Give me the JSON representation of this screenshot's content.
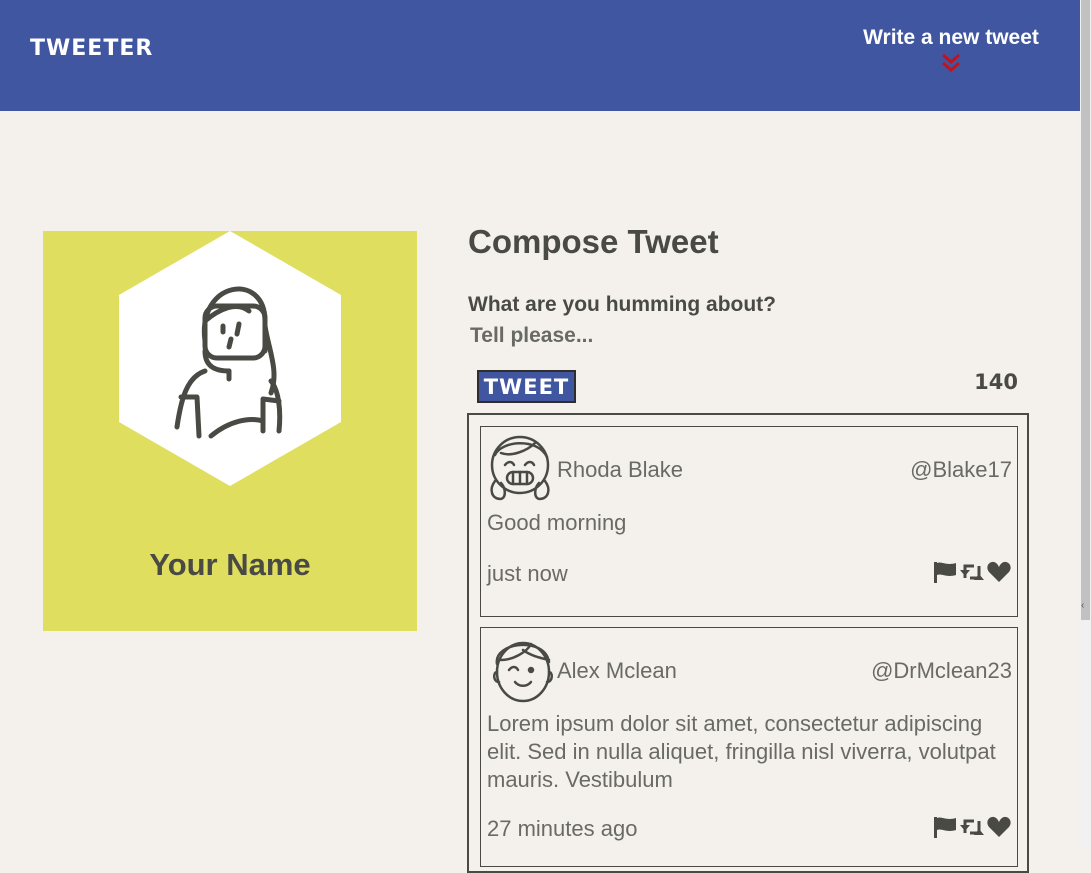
{
  "nav": {
    "brand": "TWEETER",
    "write_label": "Write a new tweet",
    "write_icon": "double-chevron-down-icon",
    "accent_color": "#4056a1",
    "chevron_color": "#c0141b"
  },
  "profile": {
    "name": "Your Name",
    "card_color": "#e0de5f",
    "avatar_icon": "woman-avatar-icon"
  },
  "compose": {
    "title": "Compose Tweet",
    "label": "What are you humming about?",
    "placeholder": "Tell please...",
    "submit_label": "TWEET",
    "counter": "140"
  },
  "tweets": [
    {
      "name": "Rhoda Blake",
      "handle": "@Blake17",
      "body": "Good morning",
      "time": "just now",
      "avatar_icon": "girl-avatar-icon",
      "actions": [
        "flag-icon",
        "retweet-icon",
        "heart-icon"
      ]
    },
    {
      "name": "Alex Mclean",
      "handle": "@DrMclean23",
      "body": "Lorem ipsum dolor sit amet, consectetur adipiscing elit. Sed in nulla aliquet, fringilla nisl viverra, volutpat mauris. Vestibulum",
      "time": "27 minutes ago",
      "avatar_icon": "boy-avatar-icon",
      "actions": [
        "flag-icon",
        "retweet-icon",
        "heart-icon"
      ]
    }
  ]
}
